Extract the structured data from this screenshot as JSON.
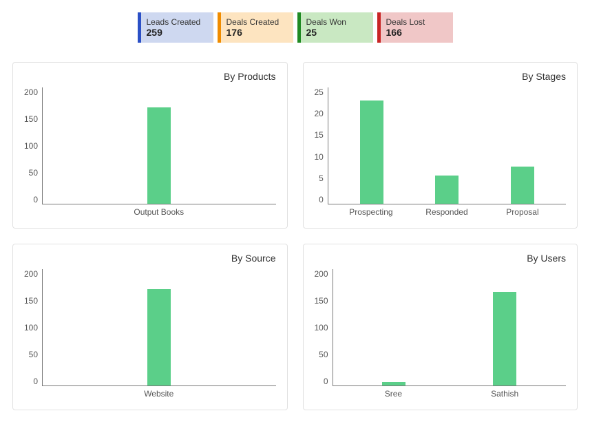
{
  "stats": [
    {
      "label": "Leads Created",
      "value": "259",
      "border": "#2b50c6",
      "bg": "#ced8f0"
    },
    {
      "label": "Deals Created",
      "value": "176",
      "border": "#f08c00",
      "bg": "#fde4c0"
    },
    {
      "label": "Deals Won",
      "value": "25",
      "border": "#1f8a23",
      "bg": "#c9e8c2"
    },
    {
      "label": "Deals Lost",
      "value": "166",
      "border": "#c82525",
      "bg": "#f0c7c7"
    }
  ],
  "charts": [
    {
      "title": "By Products",
      "ymax": 200,
      "yticks": [
        "200",
        "150",
        "100",
        "50",
        "0"
      ],
      "labels": [
        "Output Books"
      ],
      "values": [
        165
      ]
    },
    {
      "title": "By Stages",
      "ymax": 25,
      "yticks": [
        "25",
        "20",
        "15",
        "10",
        "5",
        "0"
      ],
      "labels": [
        "Prospecting",
        "Responded",
        "Proposal"
      ],
      "values": [
        22,
        6,
        8
      ]
    },
    {
      "title": "By Source",
      "ymax": 200,
      "yticks": [
        "200",
        "150",
        "100",
        "50",
        "0"
      ],
      "labels": [
        "Website"
      ],
      "values": [
        165
      ]
    },
    {
      "title": "By Users",
      "ymax": 200,
      "yticks": [
        "200",
        "150",
        "100",
        "50",
        "0"
      ],
      "labels": [
        "Sree",
        "Sathish"
      ],
      "values": [
        6,
        160
      ]
    }
  ],
  "chart_data": [
    {
      "type": "bar",
      "title": "By Products",
      "categories": [
        "Output Books"
      ],
      "values": [
        165
      ],
      "xlabel": "",
      "ylabel": "",
      "ylim": [
        0,
        200
      ]
    },
    {
      "type": "bar",
      "title": "By Stages",
      "categories": [
        "Prospecting",
        "Responded",
        "Proposal"
      ],
      "values": [
        22,
        6,
        8
      ],
      "xlabel": "",
      "ylabel": "",
      "ylim": [
        0,
        25
      ]
    },
    {
      "type": "bar",
      "title": "By Source",
      "categories": [
        "Website"
      ],
      "values": [
        165
      ],
      "xlabel": "",
      "ylabel": "",
      "ylim": [
        0,
        200
      ]
    },
    {
      "type": "bar",
      "title": "By Users",
      "categories": [
        "Sree",
        "Sathish"
      ],
      "values": [
        6,
        160
      ],
      "xlabel": "",
      "ylabel": "",
      "ylim": [
        0,
        200
      ]
    }
  ]
}
